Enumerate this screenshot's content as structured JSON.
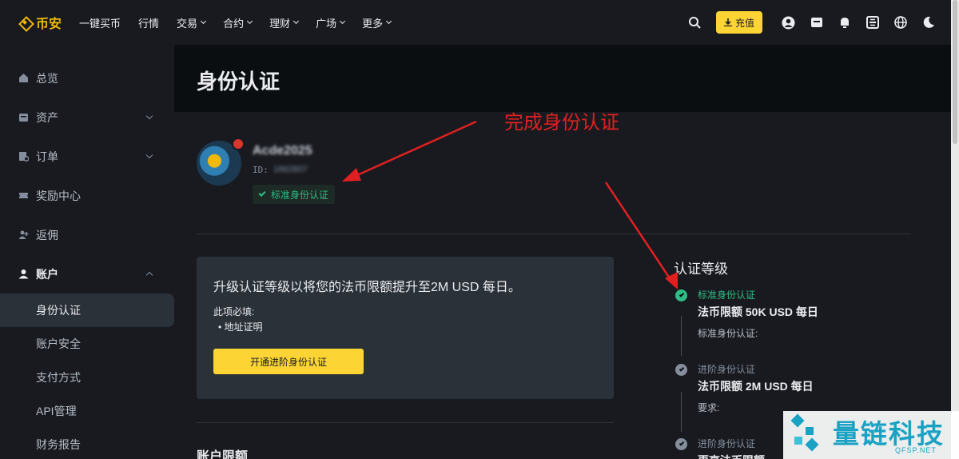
{
  "topbar": {
    "brand": "币安",
    "nav": [
      {
        "label": "一键买币",
        "dropdown": false
      },
      {
        "label": "行情",
        "dropdown": false
      },
      {
        "label": "交易",
        "dropdown": true
      },
      {
        "label": "合约",
        "dropdown": true
      },
      {
        "label": "理财",
        "dropdown": true
      },
      {
        "label": "广场",
        "dropdown": true
      },
      {
        "label": "更多",
        "dropdown": true
      }
    ],
    "deposit_label": "充值",
    "accent": "#fcd535"
  },
  "sidebar": {
    "items": [
      {
        "label": "总览"
      },
      {
        "label": "资产"
      },
      {
        "label": "订单"
      },
      {
        "label": "奖励中心"
      },
      {
        "label": "返佣"
      },
      {
        "label": "账户"
      }
    ],
    "sub_items": [
      {
        "label": "身份认证"
      },
      {
        "label": "账户安全"
      },
      {
        "label": "支付方式"
      },
      {
        "label": "API管理"
      },
      {
        "label": "财务报告"
      }
    ]
  },
  "page": {
    "title": "身份认证"
  },
  "profile": {
    "username": "Acde2025",
    "id_label": "ID:",
    "id_value": "1662807",
    "badge": "标准身份认证"
  },
  "upgrade_card": {
    "title": "升级认证等级以将您的法币限额提升至2M USD 每日。",
    "required_label": "此项必填:",
    "required_item": "地址证明",
    "button": "开通进阶身份认证"
  },
  "account_limits_title": "账户限额",
  "levels": {
    "title": "认证等级",
    "items": [
      {
        "name": "标准身份认证",
        "limit": "法币限额 50K USD 每日",
        "desc": "标准身份认证:",
        "done": true
      },
      {
        "name": "进阶身份认证",
        "limit": "法币限额 2M USD 每日",
        "desc": "要求:",
        "done": false
      },
      {
        "name": "进阶身份认证",
        "limit": "更高法币限额",
        "desc": "",
        "done": false
      }
    ]
  },
  "annotation": "完成身份认证",
  "watermark": {
    "text": "量链科技",
    "sub": "QFSP.NET"
  }
}
